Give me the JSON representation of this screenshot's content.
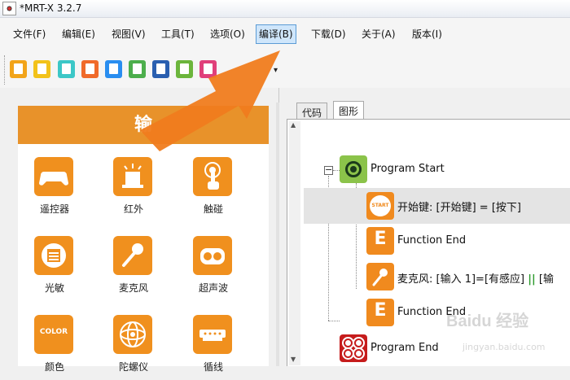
{
  "window": {
    "title": "*MRT-X 3.2.7"
  },
  "menu": {
    "items": [
      {
        "label": "文件(F)"
      },
      {
        "label": "编辑(E)"
      },
      {
        "label": "视图(V)"
      },
      {
        "label": "工具(T)"
      },
      {
        "label": "选项(O)"
      },
      {
        "label": "编译(B)",
        "active": true
      },
      {
        "label": "下载(D)"
      },
      {
        "label": "关于(A)"
      },
      {
        "label": "版本(I)"
      }
    ]
  },
  "toolbar": {
    "buttons": [
      {
        "icon": "new-file-icon",
        "color": "#f2a41a"
      },
      {
        "icon": "open-folder-icon",
        "color": "#f2c21a"
      },
      {
        "icon": "save-icon",
        "color": "#3cc7c7"
      },
      {
        "icon": "import-icon",
        "color": "#f06a2a"
      },
      {
        "icon": "export-icon",
        "color": "#2a8ef0"
      },
      {
        "icon": "document-icon",
        "color": "#4cae4c"
      },
      {
        "icon": "copy-icon",
        "color": "#2a5fb0"
      },
      {
        "icon": "clipboard-icon",
        "color": "#6cb53c"
      },
      {
        "icon": "extra-icon",
        "color": "#e0407a"
      }
    ]
  },
  "palette": {
    "header": "输",
    "items": [
      {
        "label": "遥控器",
        "icon": "gamepad-icon"
      },
      {
        "label": "红外",
        "icon": "infrared-icon"
      },
      {
        "label": "触碰",
        "icon": "touch-icon"
      },
      {
        "label": "光敏",
        "icon": "light-sensor-icon"
      },
      {
        "label": "麦克风",
        "icon": "microphone-icon"
      },
      {
        "label": "超声波",
        "icon": "ultrasonic-icon"
      },
      {
        "label": "颜色",
        "icon": "color-sensor-icon",
        "icon_text": "COLOR"
      },
      {
        "label": "陀螺仪",
        "icon": "gyroscope-icon"
      },
      {
        "label": "循线",
        "icon": "line-tracker-icon"
      }
    ]
  },
  "tabs": [
    {
      "label": "代码"
    },
    {
      "label": "图形",
      "selected": true
    }
  ],
  "blocks": {
    "program_start": "Program Start",
    "start_icon_text": "START",
    "start_key": "开始键: [开始键] = [按下]",
    "function_end_1": "Function End",
    "mic_prefix": "麦克风: [输入 1]=[有感应] ",
    "mic_bars": "||",
    "mic_suffix": " [输",
    "function_end_2": "Function End",
    "program_end": "Program End",
    "e_glyph": "E"
  },
  "watermark": {
    "logo": "Baidu 经验",
    "url": "jingyan.baidu.com"
  }
}
